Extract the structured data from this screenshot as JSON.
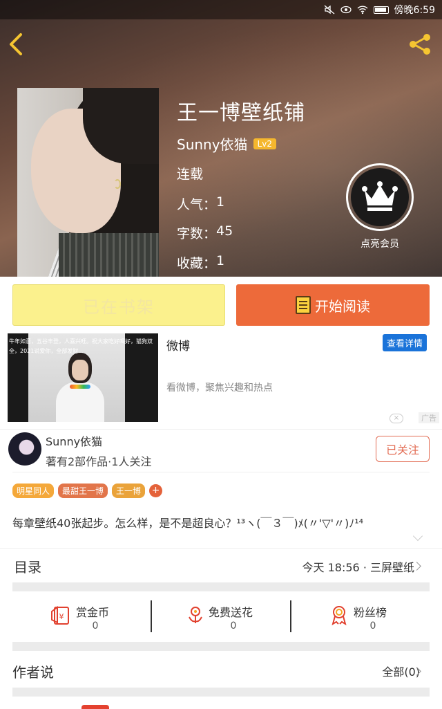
{
  "status_bar": {
    "time": "傍晚6:59"
  },
  "book": {
    "title": "王一博壁纸铺",
    "author": "Sunny依猫",
    "author_level": "Lv2",
    "status": "连载",
    "popularity_label": "人气：",
    "popularity": "1",
    "word_count_label": "字数：",
    "word_count": "45",
    "favorites_label": "收藏：",
    "favorites": "1",
    "vip_label": "点亮会员"
  },
  "actions": {
    "shelf_label": "已在书架",
    "read_label": "开始阅读"
  },
  "ad": {
    "thumb_text": "牛年如意，五谷丰登，人喜兴旺。祝大家吃好喝好，猫狗双全，2021说爱你，全部发财...",
    "title": "微博",
    "description": "看微博，聚焦兴趣和热点",
    "detail_button": "查看详情",
    "close_symbol": "×",
    "tag": "广告"
  },
  "author_card": {
    "name": "Sunny依猫",
    "meta": "著有2部作品·1人关注",
    "follow_label": "已关注"
  },
  "tags": [
    "明星同人",
    "最甜王一博",
    "王一博"
  ],
  "tag_add": "+",
  "description": "每章壁纸40张起步。怎么样，是不是超良心？¹³ヽ(￣３￣)ﾒ(〃'▽'〃)ﾉ¹⁴",
  "toc": {
    "title": "目录",
    "latest": "今天 18:56 · 三屏壁纸"
  },
  "stats": [
    {
      "label": "赏金币",
      "value": "0",
      "icon": "gift-red-envelope-icon"
    },
    {
      "label": "免费送花",
      "value": "0",
      "icon": "flower-icon"
    },
    {
      "label": "粉丝榜",
      "value": "0",
      "icon": "ribbon-medal-icon"
    }
  ],
  "author_say": {
    "title": "作者说",
    "all_label": "全部(0)"
  },
  "colors": {
    "primary_orange": "#ed6a3a",
    "shelf_yellow": "#fbf18d",
    "accent_blue": "#1a73d9"
  }
}
